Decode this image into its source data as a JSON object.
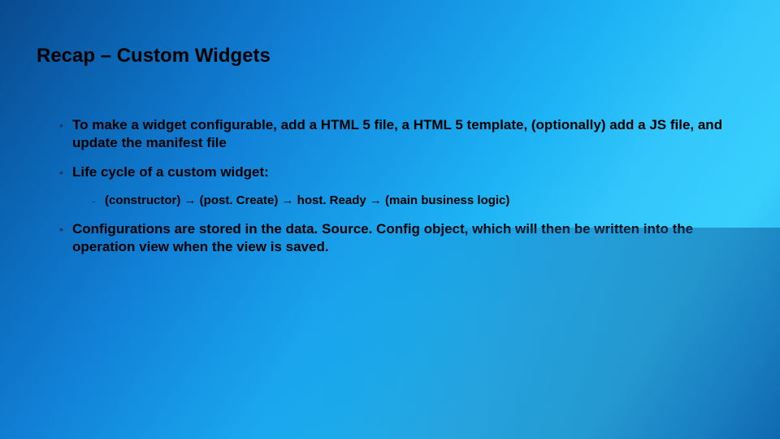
{
  "title": "Recap – Custom Widgets",
  "bullets": {
    "b1": "To make a widget configurable, add a HTML 5 file, a HTML 5 template, (optionally) add a JS file, and update the manifest file",
    "b2": "Life cycle of a custom widget:",
    "b2_sub": "(constructor) → (post. Create) → host. Ready → (main business logic)",
    "b3": "Configurations are stored in the data. Source. Config object, which will then be written into the operation view when the view is saved."
  },
  "marks": {
    "bullet": "•",
    "sub": "-"
  }
}
